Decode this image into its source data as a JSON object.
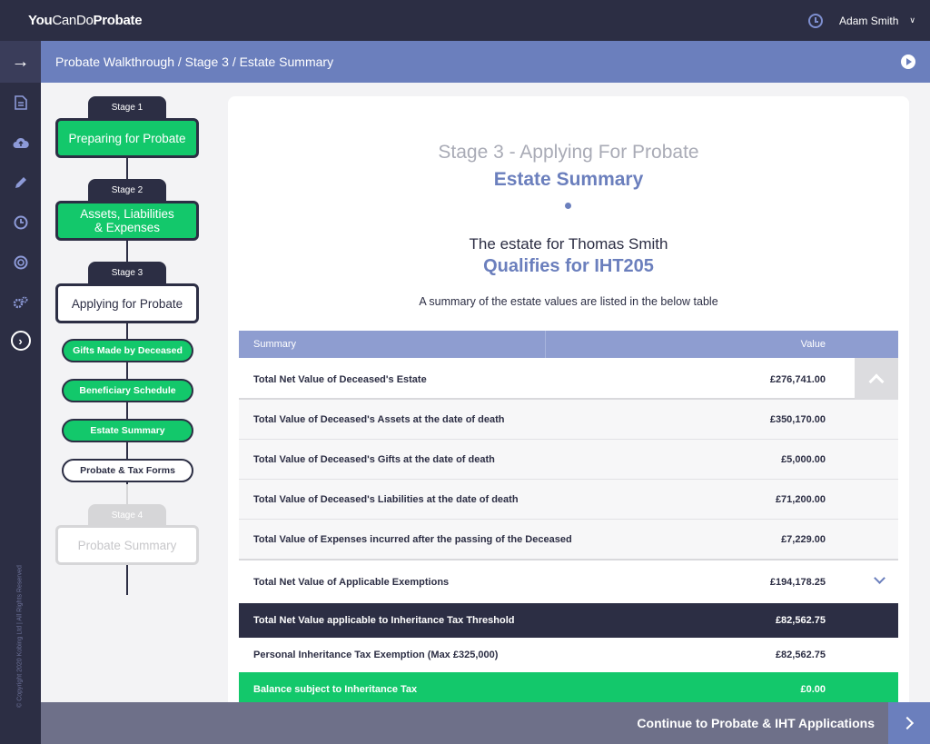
{
  "app": {
    "logo_bold_1": "You",
    "logo_light": "CanDo",
    "logo_bold_2": "Probate"
  },
  "user": {
    "name": "Adam Smith"
  },
  "breadcrumb": "Probate Walkthrough / Stage 3 / Estate Summary",
  "sidebar": {
    "copyright": "© Copyright 2020 Kobing Ltd | All Rights Reserved",
    "icons": [
      "arrow-right-icon",
      "document-icon",
      "cloud-upload-icon",
      "pencil-icon",
      "clock-icon",
      "lifebuoy-icon",
      "settings-icon",
      "chevron-right-circle-icon"
    ]
  },
  "stepper": {
    "stage1": {
      "tag": "Stage 1",
      "label": "Preparing for Probate"
    },
    "stage2": {
      "tag": "Stage 2",
      "label_line1": "Assets, Liabilities",
      "label_line2": "& Expenses"
    },
    "stage3": {
      "tag": "Stage 3",
      "label": "Applying for Probate"
    },
    "substeps": [
      "Gifts Made by Deceased",
      "Beneficiary Schedule",
      "Estate Summary",
      "Probate & Tax Forms"
    ],
    "stage4": {
      "tag": "Stage 4",
      "label": "Probate Summary"
    }
  },
  "header": {
    "stage": "Stage 3 - Applying For Probate",
    "title": "Estate Summary",
    "estate_for": "The estate for Thomas Smith",
    "qualifies": "Qualifies for IHT205",
    "note": "A summary of the estate values are listed in the below table"
  },
  "table": {
    "col_summary": "Summary",
    "col_value": "Value",
    "total_net": {
      "label": "Total Net Value of Deceased's Estate",
      "value": "£276,741.00"
    },
    "sub_rows": [
      {
        "label": "Total Value of Deceased's Assets at the date of death",
        "value": "£350,170.00"
      },
      {
        "label": "Total Value of Deceased's Gifts at the date of death",
        "value": "£5,000.00"
      },
      {
        "label": "Total Value of Deceased's Liabilities at the date of death",
        "value": "£71,200.00"
      },
      {
        "label": "Total Value of Expenses incurred after the passing of the Deceased",
        "value": "£7,229.00"
      }
    ],
    "exemptions": {
      "label": "Total Net Value of Applicable Exemptions",
      "value": "£194,178.25"
    },
    "threshold": {
      "label": "Total Net Value applicable to Inheritance Tax Threshold",
      "value": "£82,562.75"
    },
    "personal": {
      "label": "Personal Inheritance Tax Exemption (Max £325,000)",
      "value": "£82,562.75"
    },
    "balance": {
      "label": "Balance subject to Inheritance Tax",
      "value": "£0.00"
    }
  },
  "footer": {
    "continue_label": "Continue to Probate & IHT Applications"
  },
  "colors": {
    "navy": "#2c2e44",
    "accent": "#6b7fbd",
    "green": "#13c86b"
  }
}
